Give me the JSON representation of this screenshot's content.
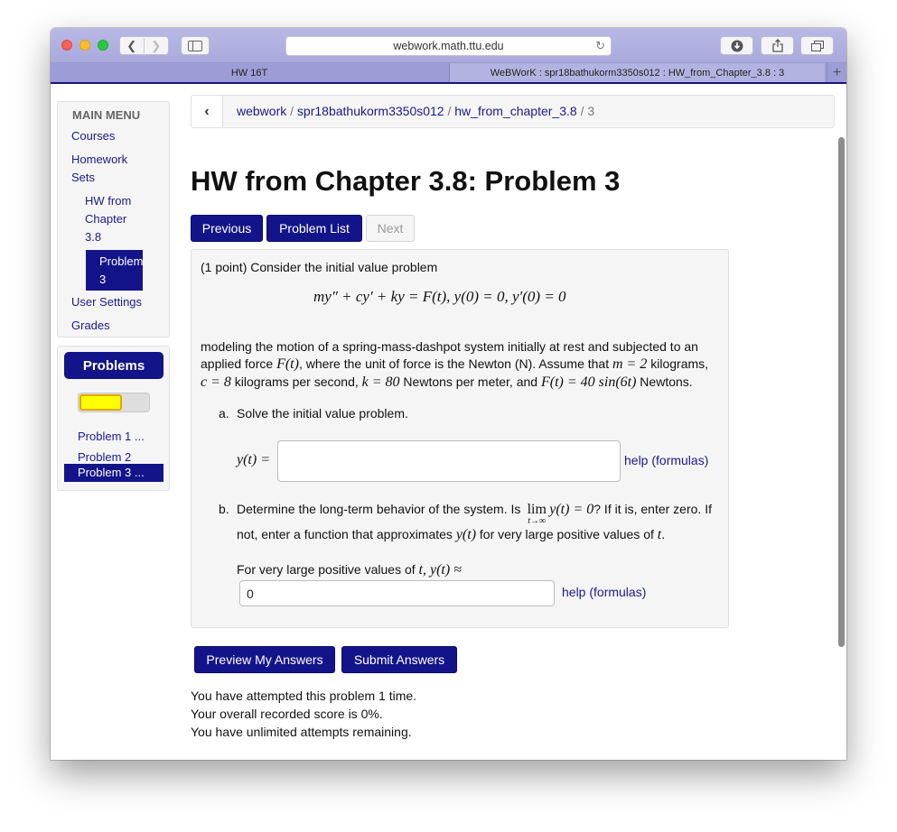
{
  "browser": {
    "url": "webwork.math.ttu.edu",
    "tabs": [
      {
        "label": "HW 16T"
      },
      {
        "label": "WeBWorK : spr18bathukorm3350s012 : HW_from_Chapter_3.8 : 3"
      }
    ],
    "new_tab": "+"
  },
  "menu": {
    "title": "MAIN MENU",
    "courses": "Courses",
    "homework_sets_1": "Homework",
    "homework_sets_2": "Sets",
    "set_1": "HW from",
    "set_2": "Chapter",
    "set_3": "3.8",
    "problem_1": "Problem",
    "problem_2": "3",
    "user_settings": "User Settings",
    "grades": "Grades"
  },
  "problems_panel": {
    "title": "Problems",
    "progress": 0.6,
    "items": [
      {
        "label": "Problem 1 ..."
      },
      {
        "label": "Problem 2"
      },
      {
        "label": "Problem 3 ..."
      }
    ]
  },
  "breadcrumb": {
    "back": "‹",
    "parts": [
      "webwork",
      "spr18bathukorm3350s012",
      "hw_from_chapter_3.8",
      "3"
    ],
    "sep": " / "
  },
  "page_title": "HW from Chapter 3.8: Problem 3",
  "nav_buttons": {
    "previous": "Previous",
    "problem_list": "Problem List",
    "next": "Next"
  },
  "problem": {
    "intro": "(1 point) Consider the initial value problem",
    "equation": "my″ + cy′ + ky = F(t),    y(0) = 0,    y′(0) = 0",
    "desc_1": "modeling the motion of a spring-mass-dashpot system initially at rest and subjected to an",
    "desc_2a": "applied force ",
    "desc_2_math1": "F(t)",
    "desc_2b": ", where the unit of force is the Newton (N). Assume that ",
    "desc_2_math2": "m = 2",
    "desc_2c": " kilograms,",
    "desc_3_math1": "c = 8",
    "desc_3a": " kilograms per second, ",
    "desc_3_math2": "k = 80",
    "desc_3b": " Newtons per meter, and ",
    "desc_3_math3": "F(t) = 40 sin(6t)",
    "desc_3c": " Newtons.",
    "part_a_marker": "a.",
    "part_a": "Solve the initial value problem.",
    "answer_a_label": "y(t) =",
    "answer_a_value": "",
    "help_a": "help (formulas)",
    "part_b_marker": "b.",
    "part_b_1a": "Determine the long-term behavior of the system. Is ",
    "part_b_lim": "lim",
    "part_b_lim_sub": "t→∞",
    "part_b_math": "y(t) = 0",
    "part_b_1b": "? If it is, enter zero. If",
    "part_b_2a": "not, enter a function that approximates ",
    "part_b_2_math": "y(t)",
    "part_b_2b": " for very large positive values of ",
    "part_b_2_math2": "t",
    "part_b_2c": ".",
    "answer_b_label_a": "For very large positive values of ",
    "answer_b_label_math": "t, y(t) ≈",
    "answer_b_value": "0",
    "help_b": "help (formulas)"
  },
  "action_buttons": {
    "preview": "Preview My Answers",
    "submit": "Submit Answers"
  },
  "status": {
    "attempts": "You have attempted this problem 1 time.",
    "score": "Your overall recorded score is 0%.",
    "remaining": "You have unlimited attempts remaining."
  }
}
